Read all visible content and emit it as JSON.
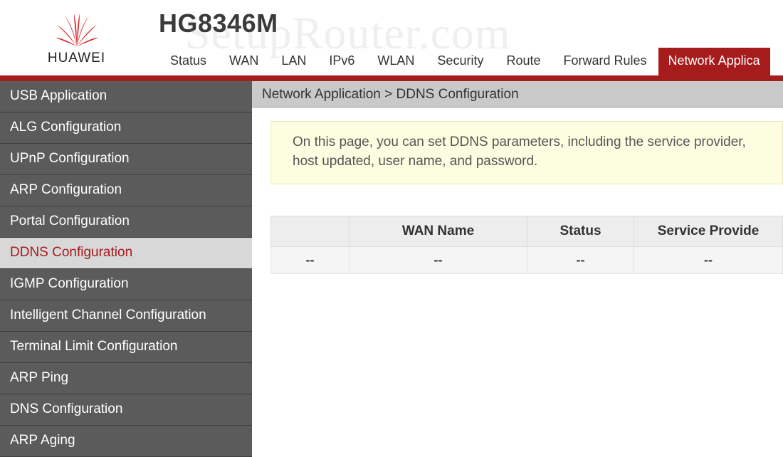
{
  "brand": "HUAWEI",
  "model": "HG8346M",
  "watermark": "SetupRouter.com",
  "topnav": {
    "items": [
      {
        "label": "Status"
      },
      {
        "label": "WAN"
      },
      {
        "label": "LAN"
      },
      {
        "label": "IPv6"
      },
      {
        "label": "WLAN"
      },
      {
        "label": "Security"
      },
      {
        "label": "Route"
      },
      {
        "label": "Forward Rules"
      },
      {
        "label": "Network Applica"
      }
    ],
    "active_index": 8
  },
  "sidebar": {
    "items": [
      {
        "label": "USB Application"
      },
      {
        "label": "ALG Configuration"
      },
      {
        "label": "UPnP Configuration"
      },
      {
        "label": "ARP Configuration"
      },
      {
        "label": "Portal Configuration"
      },
      {
        "label": "DDNS Configuration"
      },
      {
        "label": "IGMP Configuration"
      },
      {
        "label": "Intelligent Channel Configuration"
      },
      {
        "label": "Terminal Limit Configuration"
      },
      {
        "label": "ARP Ping"
      },
      {
        "label": "DNS Configuration"
      },
      {
        "label": "ARP Aging"
      }
    ],
    "active_index": 5
  },
  "breadcrumb": "Network Application > DDNS Configuration",
  "info_text": "On this page, you can set DDNS parameters, including the service provider, host updated, user name, and password.",
  "table": {
    "headers": [
      "",
      "WAN Name",
      "Status",
      "Service Provide"
    ],
    "rows": [
      [
        "--",
        "--",
        "--",
        "--"
      ]
    ]
  }
}
